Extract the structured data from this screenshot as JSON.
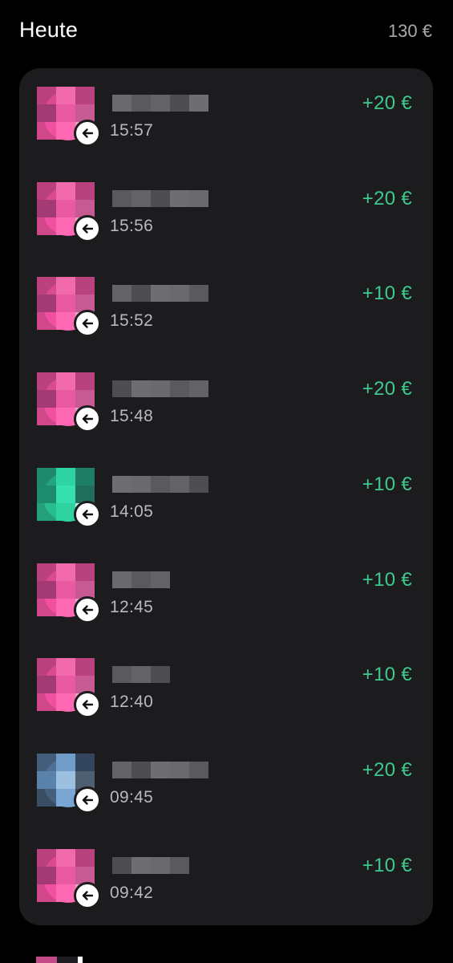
{
  "header": {
    "title": "Heute",
    "total": "130 €"
  },
  "colors": {
    "background": "#000000",
    "card": "#1c1c1e",
    "positive_amount": "#3ec98d",
    "secondary_text": "#b9b9bd"
  },
  "transactions": [
    {
      "time": "15:57",
      "amount": "+20 €",
      "avatar_color": "pink",
      "direction_icon": "arrow-left-icon"
    },
    {
      "time": "15:56",
      "amount": "+20 €",
      "avatar_color": "pink",
      "direction_icon": "arrow-left-icon"
    },
    {
      "time": "15:52",
      "amount": "+10 €",
      "avatar_color": "pink",
      "direction_icon": "arrow-left-icon"
    },
    {
      "time": "15:48",
      "amount": "+20 €",
      "avatar_color": "pink",
      "direction_icon": "arrow-left-icon"
    },
    {
      "time": "14:05",
      "amount": "+10 €",
      "avatar_color": "green",
      "direction_icon": "arrow-left-icon"
    },
    {
      "time": "12:45",
      "amount": "+10 €",
      "avatar_color": "pink",
      "direction_icon": "arrow-left-icon"
    },
    {
      "time": "12:40",
      "amount": "+10 €",
      "avatar_color": "pink",
      "direction_icon": "arrow-left-icon"
    },
    {
      "time": "09:45",
      "amount": "+20 €",
      "avatar_color": "blue",
      "direction_icon": "arrow-left-icon"
    },
    {
      "time": "09:42",
      "amount": "+10 €",
      "avatar_color": "pink",
      "direction_icon": "arrow-left-icon"
    }
  ]
}
